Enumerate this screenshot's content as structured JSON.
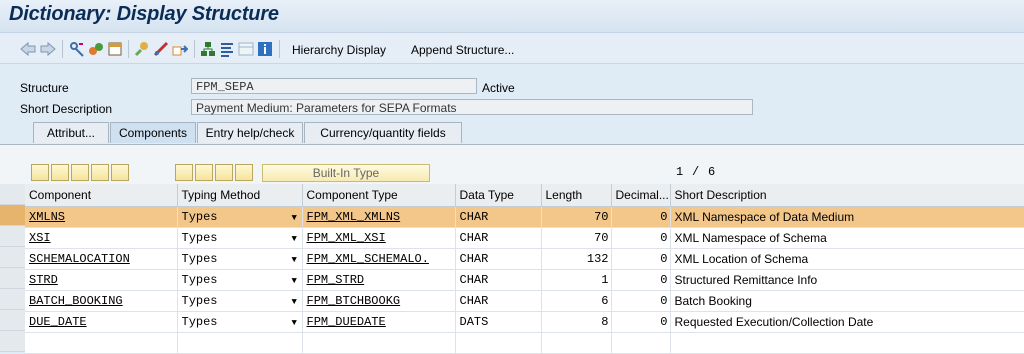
{
  "window": {
    "title": "Dictionary: Display Structure"
  },
  "toolbar": {
    "icons": [
      "back-icon",
      "forward-icon",
      "display-change-icon",
      "other-object-icon",
      "check-icon",
      "activate-icon",
      "where-used-icon",
      "object-list-icon",
      "hierarchy-icon",
      "technical-settings-icon",
      "info-icon"
    ],
    "hierarchy_label": "Hierarchy Display",
    "append_label": "Append Structure..."
  },
  "header": {
    "structure_label": "Structure",
    "structure_value": "FPM_SEPA",
    "status": "Active",
    "short_desc_label": "Short Description",
    "short_desc_value": "Payment Medium: Parameters for SEPA Formats"
  },
  "tabs": [
    {
      "label": "Attribut...",
      "active": false
    },
    {
      "label": "Components",
      "active": true
    },
    {
      "label": "Entry help/check",
      "active": false
    },
    {
      "label": "Currency/quantity fields",
      "active": false
    }
  ],
  "grid_toolbar": {
    "builtin_label": "Built-In Type",
    "page_current": "1",
    "page_sep": "/",
    "page_total": "6"
  },
  "columns": [
    "Component",
    "Typing Method",
    "Component Type",
    "Data Type",
    "Length",
    "Decimal...",
    "Short Description"
  ],
  "rows": [
    {
      "component": "XMLNS",
      "typing": "Types",
      "comp_type": "FPM_XML_XMLNS",
      "data_type": "CHAR",
      "length": "70",
      "decimal": "0",
      "desc": "XML Namespace of Data Medium",
      "selected": true
    },
    {
      "component": "XSI",
      "typing": "Types",
      "comp_type": "FPM_XML_XSI",
      "data_type": "CHAR",
      "length": "70",
      "decimal": "0",
      "desc": "XML Namespace of Schema",
      "selected": false
    },
    {
      "component": "SCHEMALOCATION",
      "typing": "Types",
      "comp_type": "FPM_XML_SCHEMALO.",
      "data_type": "CHAR",
      "length": "132",
      "decimal": "0",
      "desc": "XML Location of Schema",
      "selected": false
    },
    {
      "component": "STRD",
      "typing": "Types",
      "comp_type": "FPM_STRD",
      "data_type": "CHAR",
      "length": "1",
      "decimal": "0",
      "desc": "Structured Remittance Info",
      "selected": false
    },
    {
      "component": "BATCH_BOOKING",
      "typing": "Types",
      "comp_type": "FPM_BTCHBOOKG",
      "data_type": "CHAR",
      "length": "6",
      "decimal": "0",
      "desc": "Batch Booking",
      "selected": false
    },
    {
      "component": "DUE_DATE",
      "typing": "Types",
      "comp_type": "FPM_DUEDATE",
      "data_type": "DATS",
      "length": "8",
      "decimal": "0",
      "desc": "Requested Execution/Collection Date",
      "selected": false
    },
    {
      "component": "",
      "typing": "",
      "comp_type": "",
      "data_type": "",
      "length": "",
      "decimal": "",
      "desc": "",
      "selected": false
    }
  ]
}
